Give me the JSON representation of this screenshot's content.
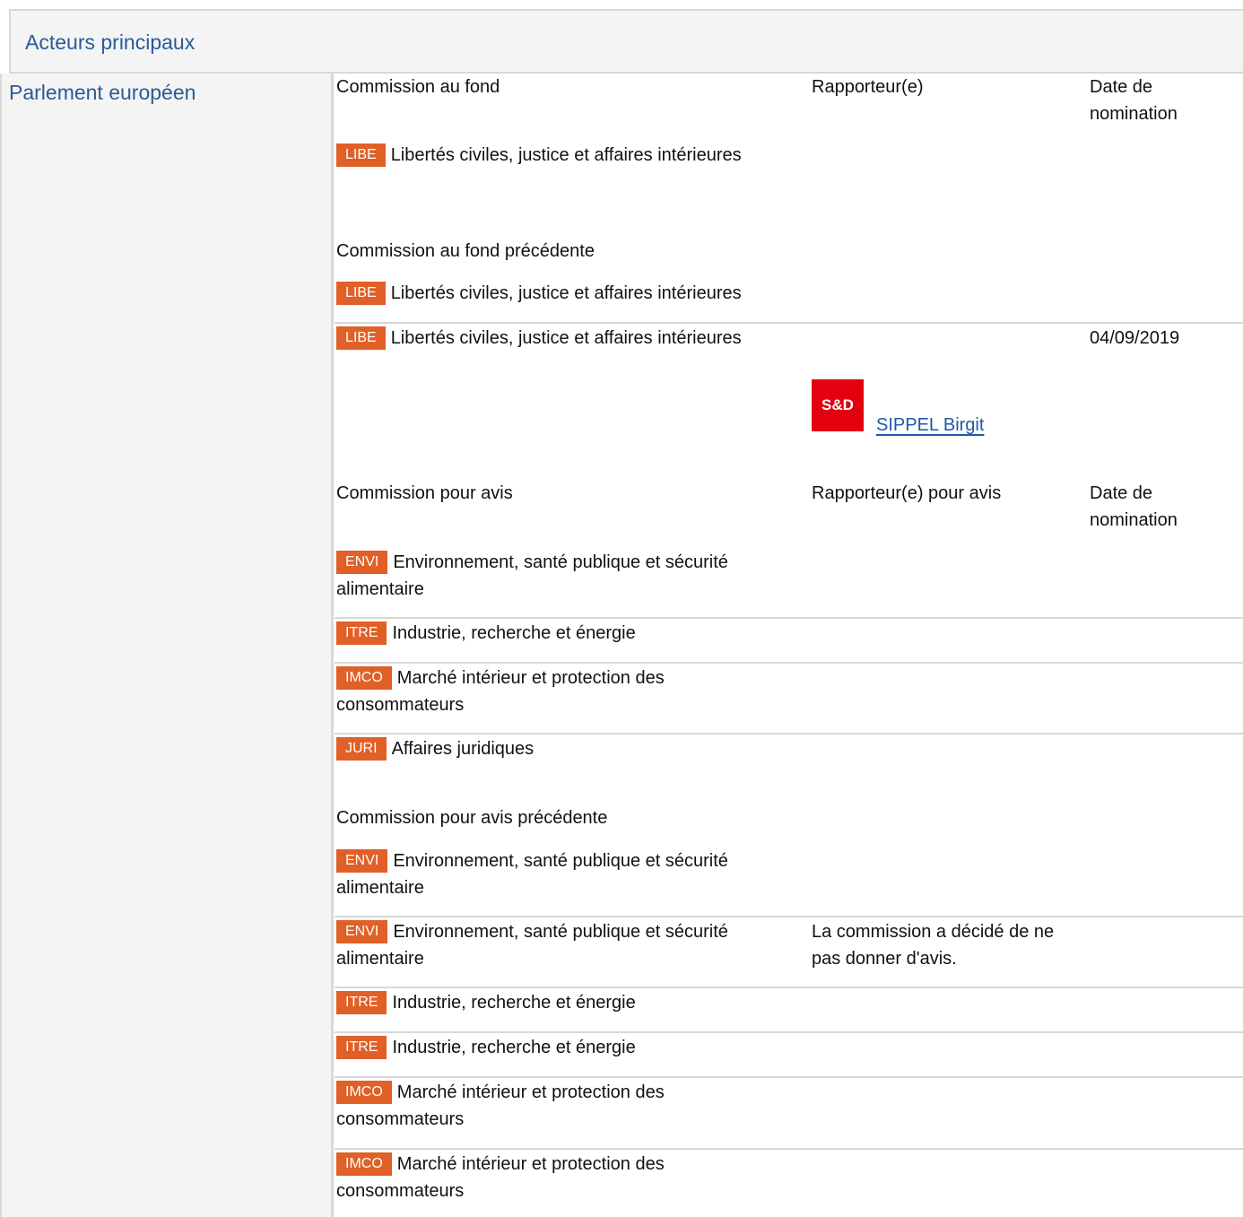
{
  "section_title": "Acteurs principaux",
  "institution": "Parlement européen",
  "headers": {
    "committee_lead": "Commission au fond",
    "rapporteur": "Rapporteur(e)",
    "date_nomination": [
      "Date de",
      "nomination"
    ],
    "committee_lead_previous": "Commission au fond précédente",
    "committee_opinion": "Commission pour avis",
    "rapporteur_opinion": "Rapporteur(e) pour avis",
    "committee_opinion_previous": "Commission pour avis précédente"
  },
  "lead": [
    {
      "code": "LIBE",
      "name": "Libertés civiles, justice et affaires intérieures"
    }
  ],
  "lead_previous": [
    {
      "code": "LIBE",
      "name": "Libertés civiles, justice et affaires intérieures"
    },
    {
      "code": "LIBE",
      "name": "Libertés civiles, justice et affaires intérieures",
      "date": "04/09/2019",
      "group_logo": "S&D",
      "rapporteur": "SIPPEL Birgit"
    }
  ],
  "opinion": [
    {
      "code": "ENVI",
      "name": [
        "Environnement, santé publique et sécurité",
        "alimentaire"
      ]
    },
    {
      "code": "ITRE",
      "name": [
        "Industrie, recherche et énergie"
      ]
    },
    {
      "code": "IMCO",
      "name": [
        "Marché intérieur et protection des",
        "consommateurs"
      ]
    },
    {
      "code": "JURI",
      "name": [
        "Affaires juridiques"
      ]
    }
  ],
  "opinion_previous": [
    {
      "code": "ENVI",
      "name": [
        "Environnement, santé publique et sécurité",
        "alimentaire"
      ]
    },
    {
      "code": "ENVI",
      "name": [
        "Environnement, santé publique et sécurité",
        "alimentaire"
      ],
      "note": [
        "La commission a décidé de ne",
        "pas donner d'avis."
      ]
    },
    {
      "code": "ITRE",
      "name": [
        "Industrie, recherche et énergie"
      ]
    },
    {
      "code": "ITRE",
      "name": [
        "Industrie, recherche et énergie"
      ]
    },
    {
      "code": "IMCO",
      "name": [
        "Marché intérieur et protection des",
        "consommateurs"
      ]
    },
    {
      "code": "IMCO",
      "name": [
        "Marché intérieur et protection des",
        "consommateurs"
      ]
    }
  ],
  "colors": {
    "badge": "#e06027",
    "link": "#2a5b96",
    "sd_logo": "#e3000f"
  }
}
